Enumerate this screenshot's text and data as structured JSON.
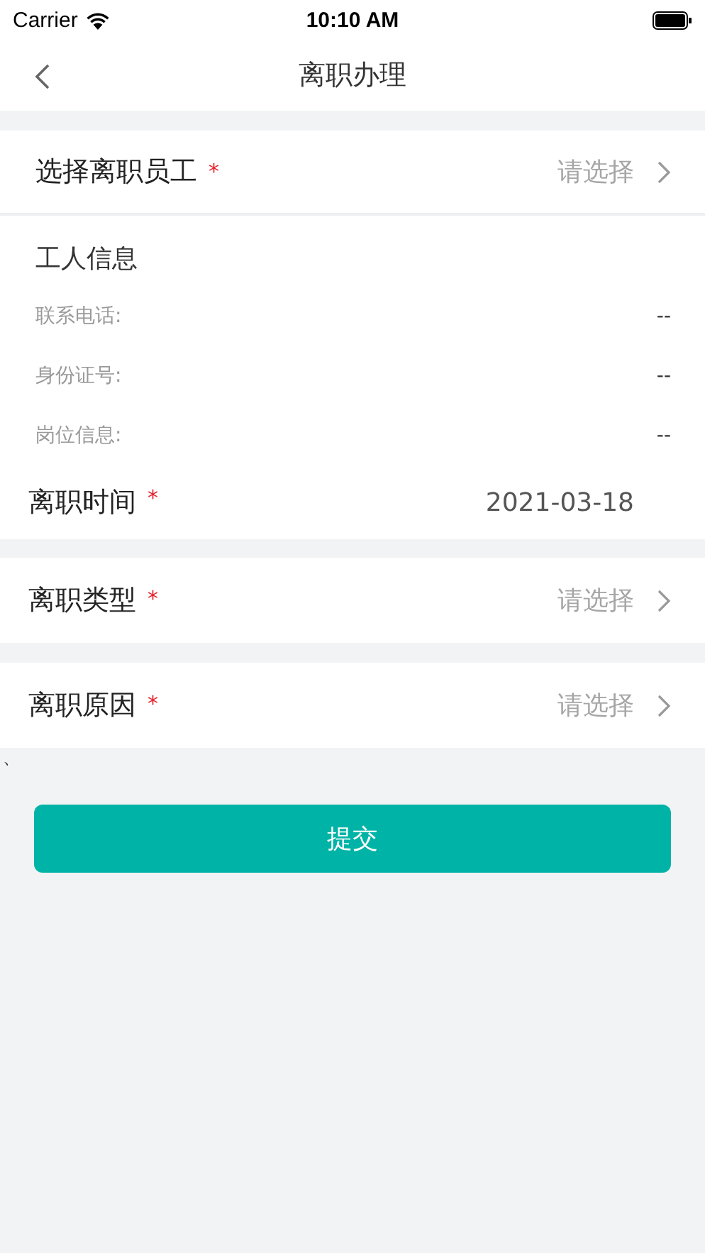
{
  "status_bar": {
    "carrier": "Carrier",
    "time": "10:10 AM"
  },
  "nav": {
    "title": "离职办理"
  },
  "employee_field": {
    "label": "选择离职员工",
    "required_mark": "*",
    "placeholder": "请选择"
  },
  "worker_info": {
    "title": "工人信息",
    "rows": [
      {
        "label": "联系电话:",
        "value": "--"
      },
      {
        "label": "身份证号:",
        "value": "--"
      },
      {
        "label": "岗位信息:",
        "value": "--"
      }
    ]
  },
  "date_field": {
    "label": "离职时间",
    "required_mark": "*",
    "value": "2021-03-18"
  },
  "select_fields": [
    {
      "label": "离职类型",
      "required_mark": "*",
      "placeholder": "请选择"
    },
    {
      "label": "离职原因",
      "required_mark": "*",
      "placeholder": "请选择"
    }
  ],
  "stray_mark": "、",
  "submit": {
    "label": "提交"
  }
}
